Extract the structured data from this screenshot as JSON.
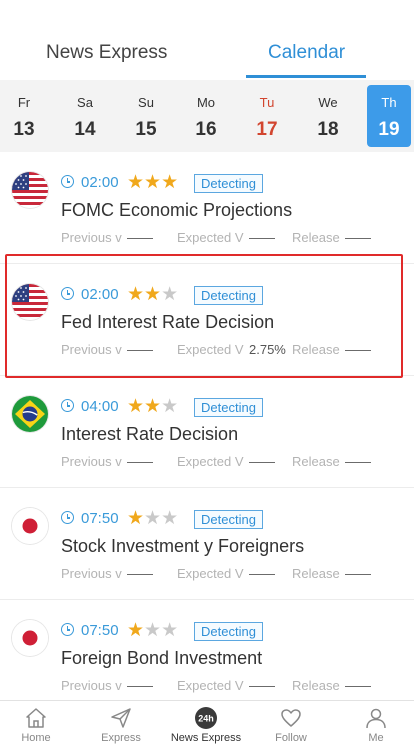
{
  "tabs": {
    "news_express": "News Express",
    "calendar": "Calendar"
  },
  "days": [
    {
      "name": "Fr",
      "num": "13"
    },
    {
      "name": "Sa",
      "num": "14"
    },
    {
      "name": "Su",
      "num": "15"
    },
    {
      "name": "Mo",
      "num": "16"
    },
    {
      "name": "Tu",
      "num": "17"
    },
    {
      "name": "We",
      "num": "18"
    },
    {
      "name": "Th",
      "num": "19"
    }
  ],
  "today_index": 4,
  "selected_index": 6,
  "labels": {
    "previous": "Previous v",
    "expected": "Expected V",
    "release": "Release"
  },
  "events": [
    {
      "country": "us-flag-icon",
      "time": "02:00",
      "stars": 3,
      "status": "Detecting",
      "title": "FOMC Economic Projections",
      "previous": "——",
      "expected": "——",
      "release": "——"
    },
    {
      "country": "us-flag-icon",
      "time": "02:00",
      "stars": 2,
      "status": "Detecting",
      "title": "Fed Interest Rate Decision",
      "previous": "——",
      "expected": "2.75%",
      "release": "——"
    },
    {
      "country": "brazil-flag-icon",
      "time": "04:00",
      "stars": 2,
      "status": "Detecting",
      "title": "Interest Rate Decision",
      "previous": "——",
      "expected": "——",
      "release": "——"
    },
    {
      "country": "japan-flag-icon",
      "time": "07:50",
      "stars": 1,
      "status": "Detecting",
      "title": "Stock Investment y Foreigners",
      "previous": "——",
      "expected": "——",
      "release": "——"
    },
    {
      "country": "japan-flag-icon",
      "time": "07:50",
      "stars": 1,
      "status": "Detecting",
      "title": "Foreign Bond Investment",
      "previous": "——",
      "expected": "——",
      "release": "——"
    }
  ],
  "nav": {
    "home": "Home",
    "express": "Express",
    "news_express": "News Express",
    "news_badge": "24h",
    "follow": "Follow",
    "me": "Me"
  },
  "colors": {
    "accent": "#2f8fd6",
    "today": "#d2452f",
    "star_on": "#f0a81c",
    "star_off": "#c9c9c9",
    "highlight": "#e02a2a"
  }
}
